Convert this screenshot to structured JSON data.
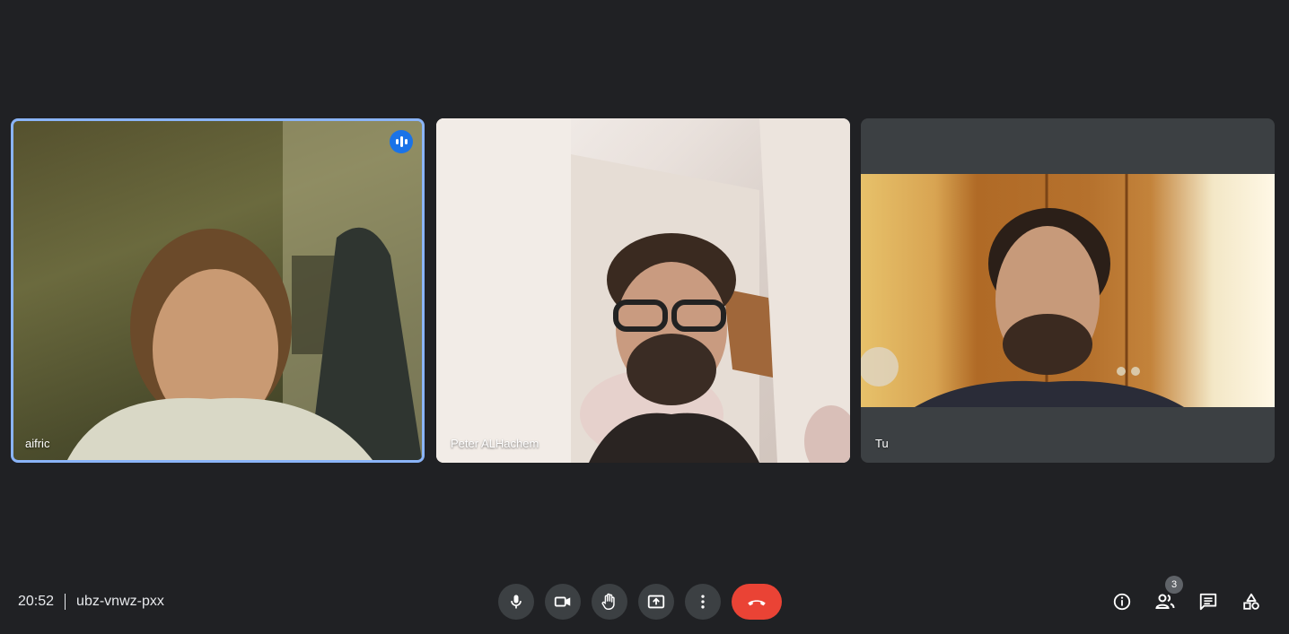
{
  "meeting": {
    "time": "20:52",
    "code": "ubz-vnwz-pxx"
  },
  "participants": [
    {
      "name": "aifric",
      "speaking": true
    },
    {
      "name": "Peter ALHachem",
      "speaking": false
    },
    {
      "name": "Tu",
      "speaking": false
    }
  ],
  "controls": {
    "mic_icon": "microphone-icon",
    "camera_icon": "camera-icon",
    "raise_hand_icon": "hand-icon",
    "present_icon": "present-screen-icon",
    "more_icon": "more-vert-icon",
    "end_icon": "phone-hangup-icon"
  },
  "side": {
    "people_count": "3",
    "info_icon": "info-icon",
    "people_icon": "people-icon",
    "chat_icon": "chat-icon",
    "activities_icon": "activities-icon"
  },
  "colors": {
    "background": "#202124",
    "active_speaker_border": "#8ab4f8",
    "end_call": "#ea4335",
    "button": "#3c4043"
  }
}
